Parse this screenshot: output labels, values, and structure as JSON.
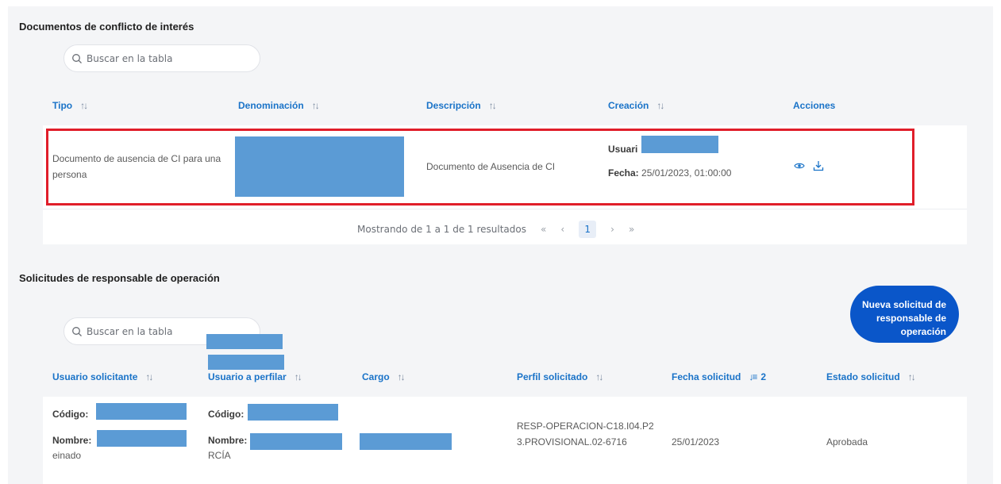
{
  "section1": {
    "title": "Documentos de conflicto de interés",
    "search_placeholder": "Buscar en la tabla",
    "columns": {
      "tipo": "Tipo",
      "denominacion": "Denominación",
      "descripcion": "Descripción",
      "creacion": "Creación",
      "acciones": "Acciones"
    },
    "row": {
      "tipo": "Documento de ausencia de CI para una persona",
      "descripcion": "Documento de Ausencia de CI",
      "usuario_label": "Usuari",
      "fecha_label": "Fecha:",
      "fecha_value": "25/01/2023, 01:00:00",
      "icons": [
        "eye-icon",
        "download-icon"
      ]
    },
    "pagination": {
      "summary": "Mostrando de 1 a 1 de 1 resultados",
      "first": "«",
      "prev": "‹",
      "current_page": "1",
      "next": "›",
      "last": "»"
    }
  },
  "section2": {
    "title": "Solicitudes de responsable de operación",
    "search_placeholder": "Buscar en la tabla",
    "new_button": "Nueva solicitud de responsable de operación",
    "columns": {
      "usuario_solicitante": "Usuario solicitante",
      "usuario_perfilar": "Usuario a perfilar",
      "cargo": "Cargo",
      "perfil": "Perfil solicitado",
      "fecha": "Fecha solicitud",
      "fecha_sort_index": "2",
      "estado": "Estado solicitud"
    },
    "row": {
      "codigo_label": "Código:",
      "nombre_label": "Nombre:",
      "solicitante_suffix": "einado",
      "perfilar_suffix": "RCÍA",
      "perfil": "RESP-OPERACION-C18.I04.P23.PROVISIONAL.02-6716",
      "fecha": "25/01/2023",
      "estado": "Aprobada"
    }
  },
  "colors": {
    "accent": "#1a73c8",
    "button": "#0a56c9",
    "highlight": "#e01e2a",
    "redaction": "#5b9bd5"
  }
}
